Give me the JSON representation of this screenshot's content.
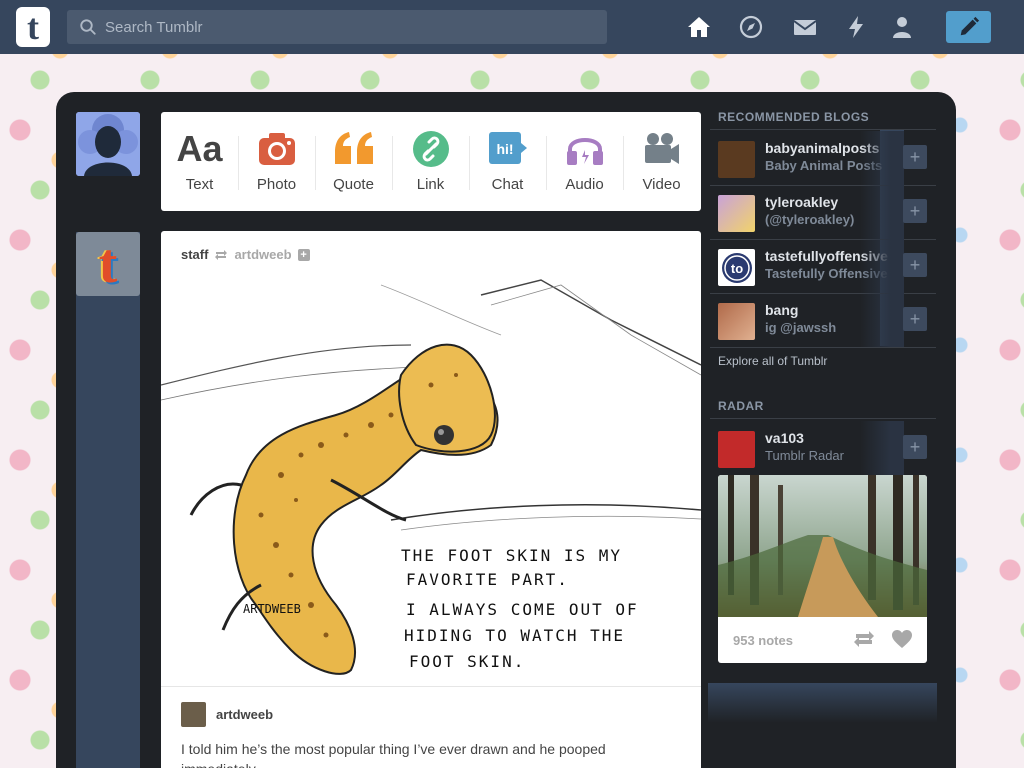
{
  "search": {
    "placeholder": "Search Tumblr"
  },
  "nav": {
    "icons": [
      "home-icon",
      "explore-icon",
      "inbox-icon",
      "activity-icon",
      "account-icon"
    ],
    "compose_icon": "pencil-icon"
  },
  "post_types": [
    {
      "label": "Text",
      "icon": "text-icon",
      "color": "#444444"
    },
    {
      "label": "Photo",
      "icon": "camera-icon",
      "color": "#d95e40"
    },
    {
      "label": "Quote",
      "icon": "quote-icon",
      "color": "#f2992e"
    },
    {
      "label": "Link",
      "icon": "link-icon",
      "color": "#56bc8a"
    },
    {
      "label": "Chat",
      "icon": "chat-icon",
      "color": "#529ecc"
    },
    {
      "label": "Audio",
      "icon": "headphones-icon",
      "color": "#a77dc2"
    },
    {
      "label": "Video",
      "icon": "video-camera-icon",
      "color": "#748089"
    }
  ],
  "post": {
    "author": "staff",
    "reblogged_from": "artdweeb",
    "art_text": {
      "line1": "THE FOOT SKIN IS MY",
      "line2": "FAVORITE PART.",
      "line3": "I ALWAYS COME OUT OF",
      "line4": "HIDING TO WATCH THE",
      "line5": "FOOT SKIN.",
      "signature": "ARTDWEEB"
    },
    "reblog_user": "artdweeb",
    "reblog_text": "I told him he’s the most popular thing I’ve ever drawn and he pooped immediately."
  },
  "sidebar": {
    "recommended_title": "RECOMMENDED BLOGS",
    "blogs": [
      {
        "name": "babyanimalposts",
        "sub": "Baby Animal Posts",
        "avatar_color": "#5a3a20"
      },
      {
        "name": "tyleroakley",
        "sub": "(@tyleroakley)",
        "avatar_color": "#c9a2d8"
      },
      {
        "name": "tastefullyoffensive",
        "sub": "Tastefully Offensive on",
        "avatar_color": "#ffffff"
      },
      {
        "name": "bang",
        "sub": "ig @jawssh",
        "avatar_color": "#b06a4a"
      }
    ],
    "explore": "Explore all of Tumblr",
    "radar_title": "RADAR",
    "radar_blog": {
      "name": "va103",
      "sub": "Tumblr Radar"
    },
    "radar_notes": "953 notes"
  },
  "colors": {
    "topbar": "#36465d",
    "accent": "#529ecc",
    "panel": "#1f2226"
  }
}
